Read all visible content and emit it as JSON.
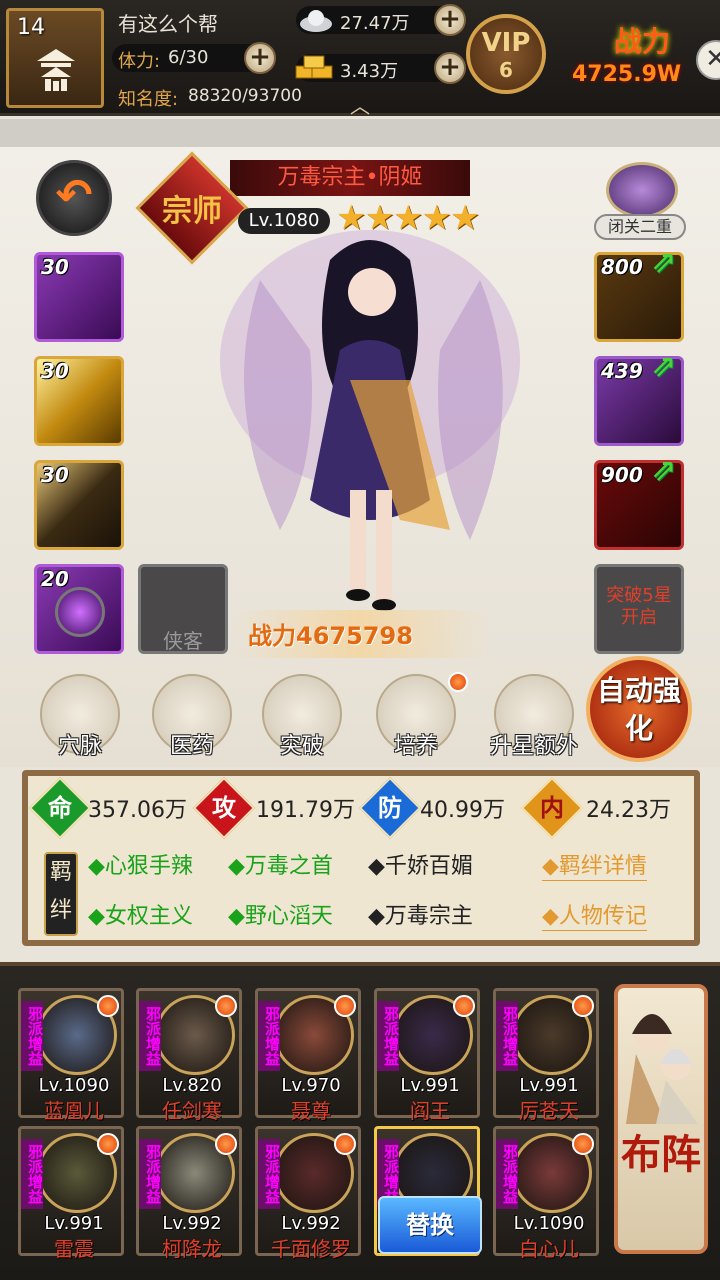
{
  "player": {
    "level": "14",
    "guild_name": "有这么个帮",
    "stamina_label": "体力:",
    "stamina": "6/30",
    "fame_label": "知名度:",
    "fame": "88320/93700"
  },
  "currency": {
    "silver": "27.47万",
    "gold": "3.43万"
  },
  "vip": {
    "label": "VIP",
    "level": "6"
  },
  "top_power": {
    "label": "战力",
    "value": "4725.9W"
  },
  "hero": {
    "name": "万毒宗主•阴姬",
    "sect_badge": "宗师",
    "level": "Lv.1080",
    "stars": "★★★★★",
    "combat_label": "战力",
    "combat_value": "4675798"
  },
  "seclusion": {
    "label": "闭关二重"
  },
  "skills": [
    {
      "level": "30"
    },
    {
      "level": "30"
    },
    {
      "level": "30"
    },
    {
      "level": "20"
    }
  ],
  "companion_slot": "侠客",
  "equipment": [
    {
      "level": "800"
    },
    {
      "level": "439"
    },
    {
      "level": "900"
    }
  ],
  "breakthrough_lock": "突破5星开启",
  "functions": [
    {
      "label": "穴脉"
    },
    {
      "label": "医药"
    },
    {
      "label": "突破"
    },
    {
      "label": "培养"
    },
    {
      "label": "升星额外"
    }
  ],
  "auto_enhance": "自动强化",
  "stats": [
    {
      "icon": "命",
      "value": "357.06万",
      "color": "#1a9a2a"
    },
    {
      "icon": "攻",
      "value": "191.79万",
      "color": "#c8141a"
    },
    {
      "icon": "防",
      "value": "40.99万",
      "color": "#1a6ad8"
    },
    {
      "icon": "内",
      "value": "24.23万",
      "color": "#e0941a"
    }
  ],
  "bond_tag": "羁绊",
  "bonds": [
    {
      "text": "◆心狠手辣",
      "active": true
    },
    {
      "text": "◆万毒之首",
      "active": true
    },
    {
      "text": "◆千娇百媚",
      "active": false
    },
    {
      "text": "◆女权主义",
      "active": true
    },
    {
      "text": "◆野心滔天",
      "active": true
    },
    {
      "text": "◆万毒宗主",
      "active": false
    }
  ],
  "bond_details": "◆羁绊详情",
  "biography": "◆人物传记",
  "evil_tag": "邪派增益",
  "roster": [
    {
      "level": "Lv.1090",
      "name": "蓝凰儿"
    },
    {
      "level": "Lv.820",
      "name": "任剑寒"
    },
    {
      "level": "Lv.970",
      "name": "聂尊"
    },
    {
      "level": "Lv.991",
      "name": "阎王"
    },
    {
      "level": "Lv.991",
      "name": "厉苍天"
    },
    {
      "level": "Lv.991",
      "name": "雷震"
    },
    {
      "level": "Lv.992",
      "name": "柯降龙"
    },
    {
      "level": "Lv.992",
      "name": "千面修罗"
    },
    {
      "level": "",
      "name": ""
    },
    {
      "level": "Lv.1090",
      "name": "白心儿"
    }
  ],
  "replace_button": "替换",
  "formation": "布阵"
}
